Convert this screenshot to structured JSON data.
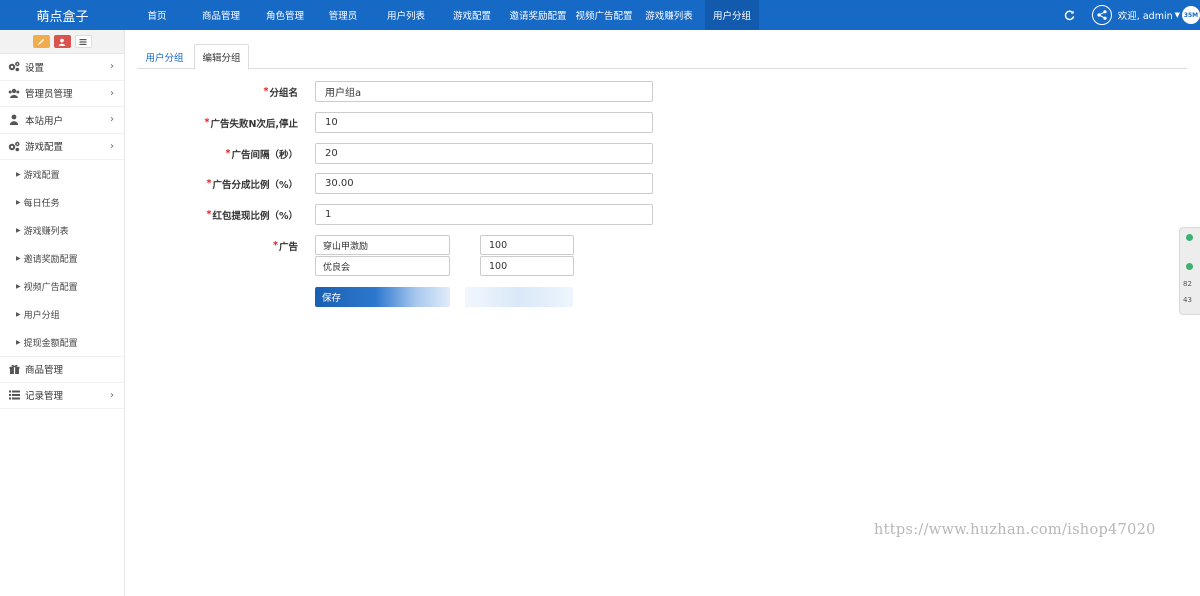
{
  "app": {
    "title": "萌点盒子"
  },
  "topnav": {
    "items": [
      "首页",
      "商品管理",
      "角色管理",
      "管理员",
      "用户列表",
      "游戏配置",
      "邀请奖励配置",
      "视频广告配置",
      "游戏赚列表",
      "用户分组"
    ],
    "active_index": 9,
    "welcome": "欢迎, admin",
    "avatar_text": "35M"
  },
  "sidebar": {
    "menu": [
      {
        "label": "设置",
        "icon": "gears-icon"
      },
      {
        "label": "管理员管理",
        "icon": "users-icon"
      },
      {
        "label": "本站用户",
        "icon": "user-icon"
      },
      {
        "label": "游戏配置",
        "icon": "gears-icon"
      }
    ],
    "submenu": [
      "游戏配置",
      "每日任务",
      "游戏赚列表",
      "邀请奖励配置",
      "视频广告配置",
      "用户分组",
      "提现金额配置"
    ],
    "bottom_menu": [
      {
        "label": "商品管理",
        "icon": "gift-icon"
      },
      {
        "label": "记录管理",
        "icon": "list-icon"
      }
    ]
  },
  "tabs": [
    "用户分组",
    "编辑分组"
  ],
  "form": {
    "fields": [
      {
        "label": "分组名",
        "value": "用户组a"
      },
      {
        "label": "广告失败N次后,停止",
        "value": "10"
      },
      {
        "label": "广告间隔（秒）",
        "value": "20"
      },
      {
        "label": "广告分成比例（%）",
        "value": "30.00"
      },
      {
        "label": "红包提现比例（%）",
        "value": "1"
      }
    ],
    "ad_label": "广告",
    "ads": [
      {
        "name": "穿山甲激励",
        "value": "100"
      },
      {
        "name": "优良会",
        "value": "100"
      }
    ],
    "save_label": "保存"
  },
  "float_widget": {
    "line1": "82",
    "line2": "43"
  },
  "watermark": "https://www.huzhan.com/ishop47020"
}
